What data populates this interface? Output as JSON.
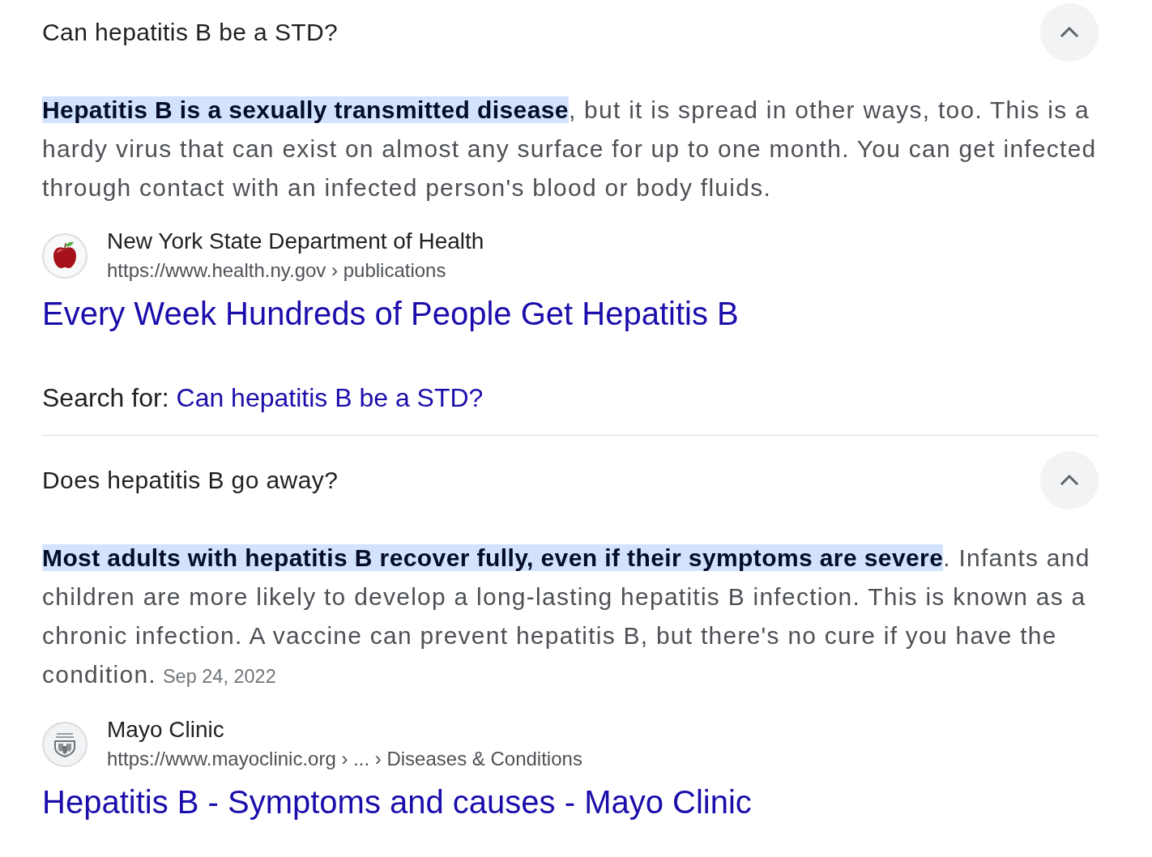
{
  "items": [
    {
      "question": "Can hepatitis B be a STD?",
      "expanded": true,
      "answer": "**Hepatitis B is a sexually transmitted disease**, but it is spread in other ways, too. This is a hardy virus that can exist on almost any surface for up to one month. You can get infected through contact with an infected person's blood or body fluids.",
      "source": {
        "name": "New York State Department of Health",
        "url": "https://www.health.ny.gov › publications",
        "title": "Every Week Hundreds of People Get Hepatitis B"
      },
      "search_for": {
        "label": "Search for:",
        "query": "Can hepatitis B be a STD?"
      }
    },
    {
      "question": "Does hepatitis B go away?",
      "expanded": true,
      "answer": "**Most adults with hepatitis B recover fully, even if their symptoms are severe**. Infants and children are more likely to develop a long-lasting hepatitis B infection. This is known as a chronic infection. A vaccine can prevent hepatitis B, but there's no cure if you have the condition.",
      "date": "Sep 24, 2022",
      "source": {
        "name": "Mayo Clinic",
        "url": "https://www.mayoclinic.org › ... › Diseases & Conditions",
        "title": "Hepatitis B - Symptoms and causes - Mayo Clinic"
      }
    }
  ]
}
